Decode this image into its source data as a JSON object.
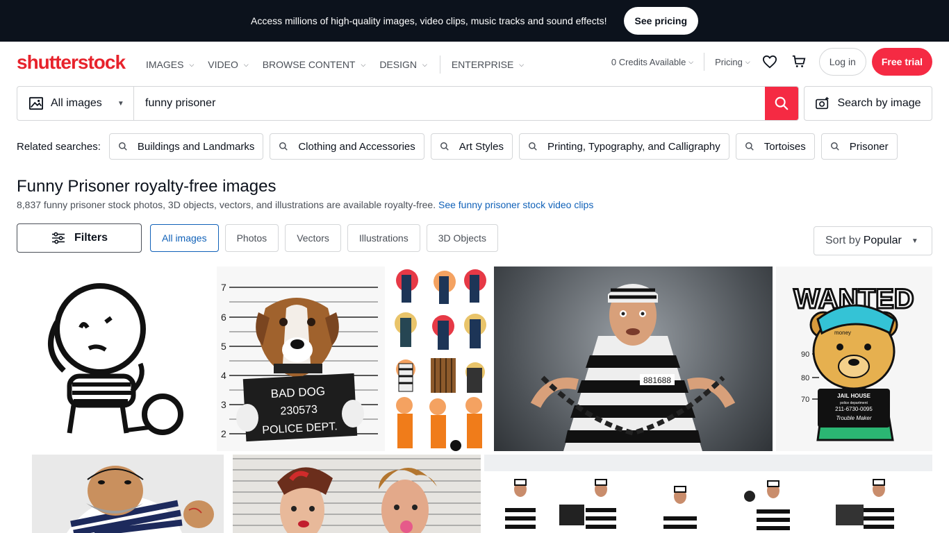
{
  "promo": {
    "text": "Access millions of high-quality images, video clips, music tracks and sound effects!",
    "button": "See pricing"
  },
  "header": {
    "logo": "shutterstock",
    "nav": [
      "IMAGES",
      "VIDEO",
      "BROWSE CONTENT",
      "DESIGN",
      "ENTERPRISE"
    ],
    "credits": "0 Credits Available",
    "pricing": "Pricing",
    "login": "Log in",
    "free_trial": "Free trial"
  },
  "search": {
    "asset_type": "All images",
    "query": "funny prisoner",
    "search_by_image": "Search by image"
  },
  "related": {
    "label": "Related searches:",
    "items": [
      "Buildings and Landmarks",
      "Clothing and Accessories",
      "Art Styles",
      "Printing, Typography, and Calligraphy",
      "Tortoises",
      "Prisoner"
    ]
  },
  "results": {
    "title": "Funny Prisoner royalty-free images",
    "subtitle": "8,837 funny prisoner stock photos, 3D objects, vectors, and illustrations are available royalty-free.",
    "video_link": "See funny prisoner stock video clips"
  },
  "filters": {
    "button": "Filters",
    "tabs": [
      "All images",
      "Photos",
      "Vectors",
      "Illustrations",
      "3D Objects"
    ],
    "active_tab": "All images",
    "sort_prefix": "Sort by",
    "sort_value": "Popular"
  },
  "images": {
    "dog_sign": [
      "BAD DOG",
      "230573",
      "POLICE DEPT."
    ],
    "dog_scale": [
      "7",
      "6",
      "5",
      "4",
      "3",
      "2"
    ],
    "man_number": "881688",
    "wanted_title": "WANTED",
    "wanted_jail": "JAIL HOUSE",
    "wanted_dept": "police department",
    "wanted_phone": "211-6730-0095",
    "wanted_trouble": "Trouble Maker",
    "wanted_scale": [
      "90",
      "80",
      "70"
    ],
    "wanted_money": "money"
  },
  "colors": {
    "brand": "#e7232c",
    "accent": "#f52a43",
    "link": "#1061b8",
    "dark": "#0c121c"
  }
}
